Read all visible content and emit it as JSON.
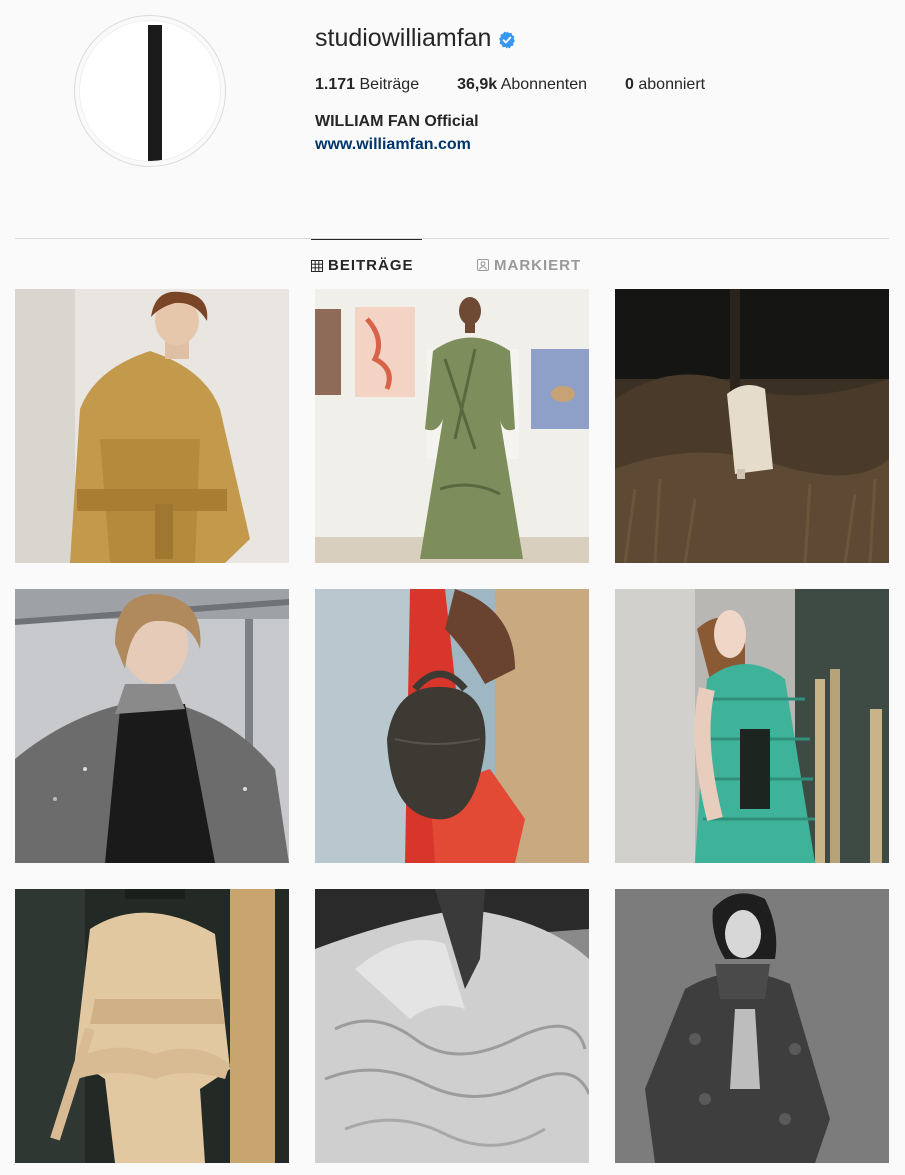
{
  "profile": {
    "username": "studiowilliamfan",
    "verified": true,
    "stats": {
      "posts_count": "1.171",
      "posts_label": "Beiträge",
      "followers_count": "36,9k",
      "followers_label": "Abonnenten",
      "following_count": "0",
      "following_label": "abonniert"
    },
    "full_name": "WILLIAM FAN Official",
    "website": "www.williamfan.com"
  },
  "tabs": {
    "posts": "BEITRÄGE",
    "tagged": "MARKIERT"
  },
  "colors": {
    "link": "#003569",
    "verified_badge": "#3897f0",
    "text": "#262626",
    "muted": "#999999"
  }
}
